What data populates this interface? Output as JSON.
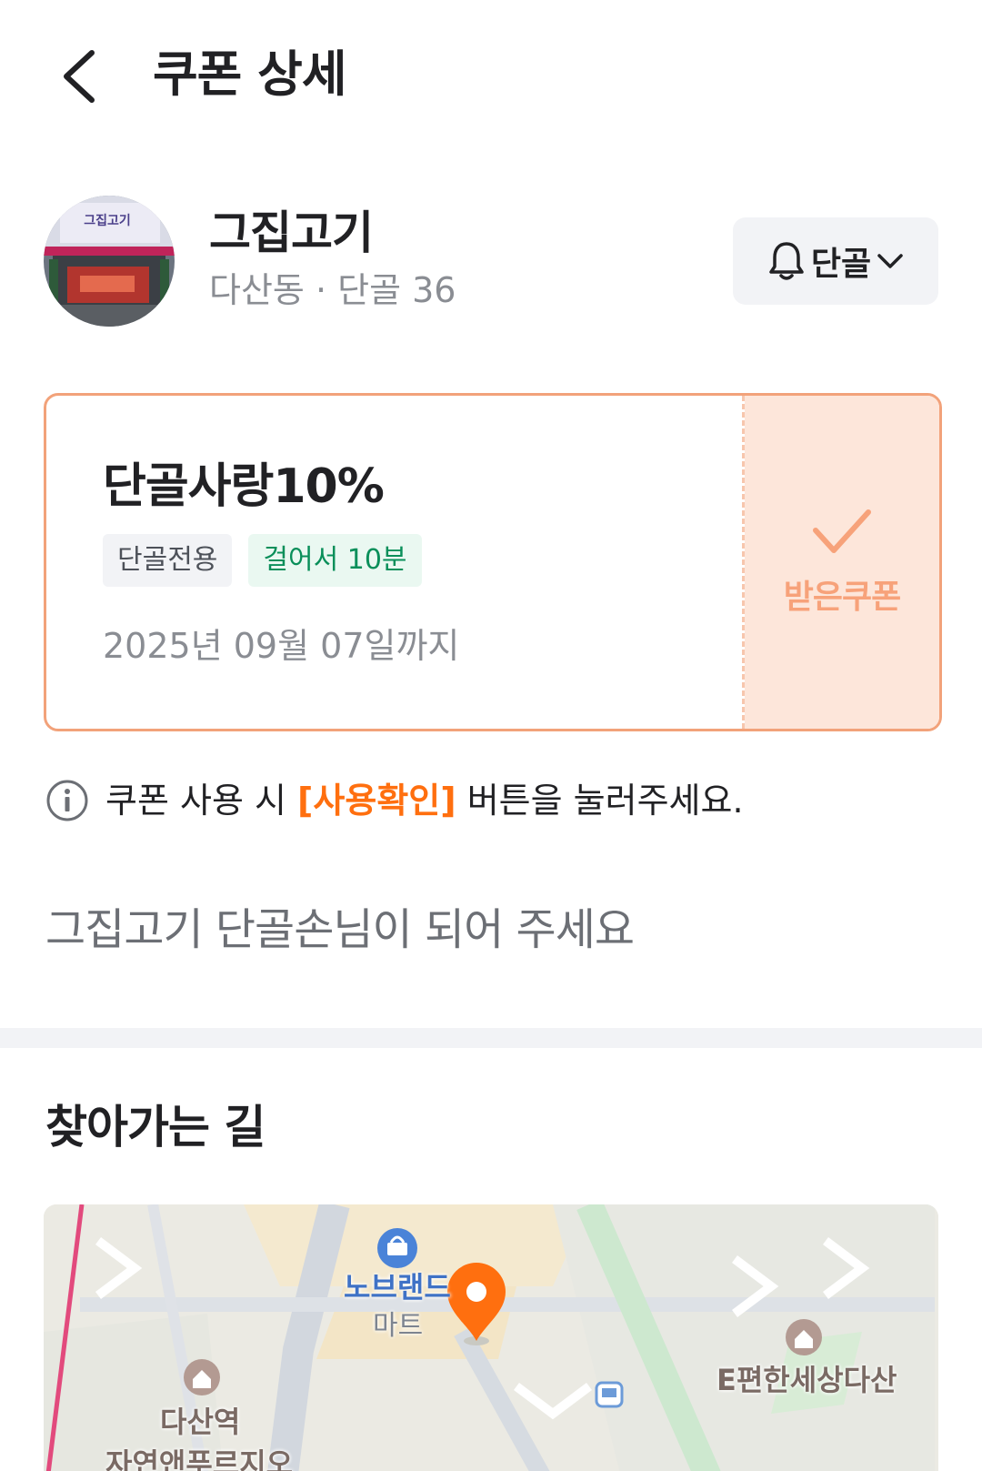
{
  "header": {
    "title": "쿠폰 상세",
    "back_icon": "chevron-left-icon"
  },
  "store": {
    "name": "그집고기",
    "meta": "다산동 · 단골 36",
    "sign_text": "그집고기",
    "regular_button": {
      "label": "단골",
      "icon": "bell-icon",
      "caret": "chevron-down-icon"
    }
  },
  "coupon": {
    "title": "단골사랑10%",
    "tags": [
      "단골전용",
      "걸어서 10분"
    ],
    "valid_until": "2025년 09월 07일까지",
    "status_label": "받은쿠폰",
    "status_icon": "check-icon"
  },
  "notice": {
    "prefix": "쿠폰 사용 시 ",
    "highlight": "[사용확인]",
    "suffix": " 버튼을 눌러주세요."
  },
  "invite_text": "그집고기 단골손님이 되어 주세요",
  "directions": {
    "title": "찾아가는 길",
    "map_labels": {
      "mart_line1": "노브랜드",
      "mart_line2": "마트",
      "station_line1": "다산역",
      "station_line2": "자연앤푸르지오",
      "apartment": "E편한세상다산"
    }
  },
  "colors": {
    "accent": "#ff6f0f",
    "coupon_border": "#f2a27a",
    "coupon_stub": "#fde6da",
    "tag_green": "#0a8f5a"
  }
}
